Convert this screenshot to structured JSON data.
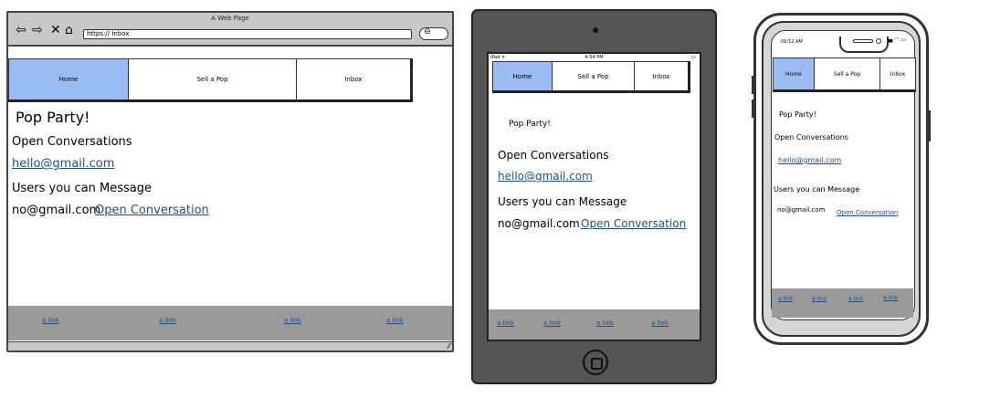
{
  "browser": {
    "window_title": "A Web Page",
    "url": "https:// Inbox",
    "nav": [
      "Home",
      "Sell a Pop",
      "Inbox"
    ],
    "app_title": "Pop Party!",
    "open_conversations_label": "Open Conversations",
    "open_conversation_email": "hello@gmail.com",
    "users_label": "Users you can Message",
    "user_email": "no@gmail.com",
    "open_conversation_link": "Open Conversation",
    "footer_links": [
      "a link",
      "a link",
      "a link",
      "a link"
    ]
  },
  "tablet": {
    "status_left": "iPad ᯤ",
    "status_time": "4:54 PM",
    "status_battery": "▭",
    "nav": [
      "Home",
      "Sell a Pop",
      "Inbox"
    ],
    "app_title": "Pop Party!",
    "open_conversations_label": "Open Conversations",
    "open_conversation_email": "hello@gmail.com",
    "users_label": "Users you can Message",
    "user_email": "no@gmail.com",
    "open_conversation_link": "Open Conversation",
    "footer_links": [
      "a link",
      "a link",
      "a link",
      "a link"
    ]
  },
  "phone": {
    "status_time": "09:52 AM",
    "nav": [
      "Home",
      "Sell a Pop",
      "Inbox"
    ],
    "app_title": "Pop Party!",
    "open_conversations_label": "Open Conversations",
    "open_conversation_email": "hello@gmail.com",
    "users_label": "Users you can Message",
    "user_email": "no@gmail.com",
    "open_conversation_link": "Open Conversation",
    "footer_links": [
      "a link",
      "a link",
      "a link",
      "a link"
    ]
  },
  "colors": {
    "active_tab": "#9bbcf2",
    "link": "#1f4e8a",
    "footer": "#9a9a9a",
    "chrome": "#c8c8c8",
    "tablet_body": "#555555"
  }
}
